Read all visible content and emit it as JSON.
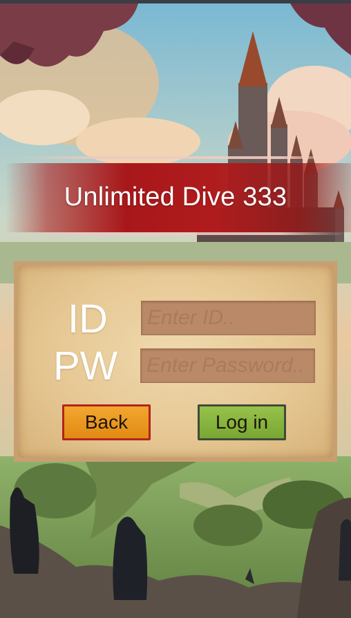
{
  "app": {
    "title": "Unlimited Dive 333"
  },
  "login_form": {
    "id_label": "ID",
    "pw_label": "PW",
    "id_placeholder": "Enter ID..",
    "pw_placeholder": "Enter Password..",
    "id_value": "",
    "pw_value": ""
  },
  "buttons": {
    "back_label": "Back",
    "login_label": "Log in"
  },
  "colors": {
    "banner_red": "#b01c1e",
    "parchment": "#e6c894",
    "back_button": "#e08a14",
    "login_button": "#78a733"
  }
}
